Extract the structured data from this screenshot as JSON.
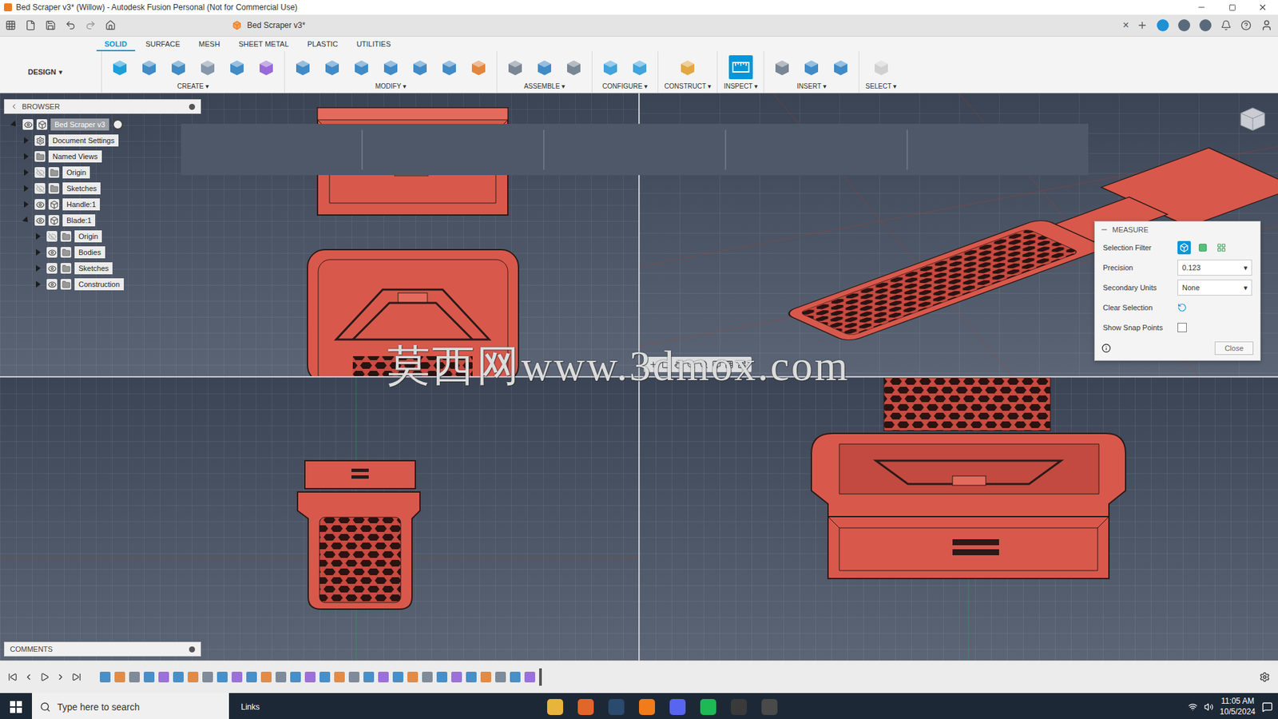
{
  "window": {
    "title": "Bed Scraper v3* (Willow) - Autodesk Fusion Personal (Not for Commercial Use)"
  },
  "document_tab": {
    "title": "Bed Scraper v3*",
    "close": "×"
  },
  "workspace": {
    "label": "DESIGN",
    "arrow": "▾"
  },
  "tabs": [
    {
      "label": "SOLID",
      "selected": true
    },
    {
      "label": "SURFACE",
      "selected": false
    },
    {
      "label": "MESH",
      "selected": false
    },
    {
      "label": "SHEET METAL",
      "selected": false
    },
    {
      "label": "PLASTIC",
      "selected": false
    },
    {
      "label": "UTILITIES",
      "selected": false
    }
  ],
  "tool_groups": [
    {
      "label": "CREATE ▾",
      "active": false
    },
    {
      "label": "MODIFY ▾",
      "active": false
    },
    {
      "label": "ASSEMBLE ▾",
      "active": false
    },
    {
      "label": "CONFIGURE ▾",
      "active": false
    },
    {
      "label": "CONSTRUCT ▾",
      "active": false
    },
    {
      "label": "INSPECT ▾",
      "active": true
    },
    {
      "label": "INSERT ▾",
      "active": false
    },
    {
      "label": "SELECT ▾",
      "active": false
    }
  ],
  "browser": {
    "title": "BROWSER",
    "items": [
      {
        "label": "Bed Scraper v3",
        "kind": "root",
        "visible": true,
        "expanded": true,
        "active": true,
        "children": [
          {
            "label": "Document Settings",
            "kind": "settings",
            "expanded": false,
            "active": false,
            "children": []
          },
          {
            "label": "Named Views",
            "kind": "folder",
            "expanded": false,
            "active": false,
            "children": []
          },
          {
            "label": "Origin",
            "kind": "folder",
            "visible": false,
            "expanded": false,
            "active": false,
            "children": []
          },
          {
            "label": "Sketches",
            "kind": "folder",
            "visible": false,
            "expanded": false,
            "active": false,
            "children": []
          },
          {
            "label": "Handle:1",
            "kind": "component",
            "visible": true,
            "expanded": false,
            "active": false,
            "children": []
          },
          {
            "label": "Blade:1",
            "kind": "component",
            "visible": true,
            "expanded": true,
            "active": false,
            "children": [
              {
                "label": "Origin",
                "kind": "folder",
                "visible": false,
                "expanded": false,
                "active": false,
                "children": []
              },
              {
                "label": "Bodies",
                "kind": "folder",
                "visible": true,
                "expanded": false,
                "active": false,
                "children": []
              },
              {
                "label": "Sketches",
                "kind": "folder",
                "visible": true,
                "expanded": false,
                "active": false,
                "children": []
              },
              {
                "label": "Construction",
                "kind": "folder",
                "visible": true,
                "expanded": false,
                "active": false,
                "children": []
              }
            ]
          }
        ]
      }
    ]
  },
  "measure": {
    "title": "MEASURE",
    "rows": [
      {
        "label": "Selection Filter",
        "kind": "filters"
      },
      {
        "label": "Precision",
        "kind": "select",
        "value": "0.123"
      },
      {
        "label": "Secondary Units",
        "kind": "select",
        "value": "None"
      },
      {
        "label": "Clear Selection",
        "kind": "button"
      },
      {
        "label": "Show Snap Points",
        "kind": "checkbox",
        "checked": false
      }
    ],
    "close": "Close"
  },
  "comments": {
    "title": "COMMENTS"
  },
  "watermark": "莫西网www.3dmox.com",
  "taskbar": {
    "search": "Type here to search",
    "links": "Links",
    "time": "11:05 AM",
    "date": "10/5/2024"
  }
}
